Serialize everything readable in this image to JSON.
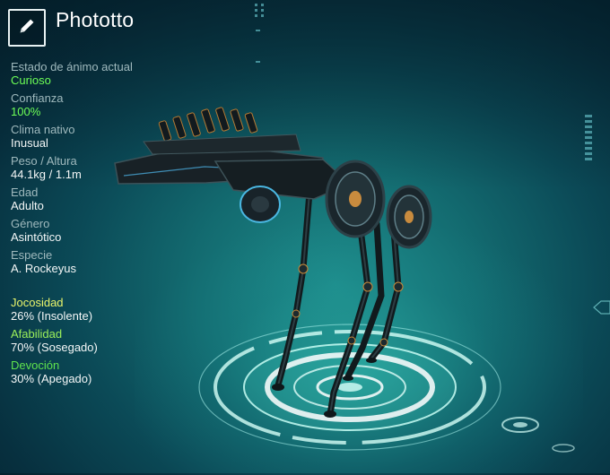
{
  "creature": {
    "name": "Phototto"
  },
  "stats": [
    {
      "label": "Estado de ánimo actual",
      "value": "Curioso",
      "highlight": true
    },
    {
      "label": "Confianza",
      "value": "100%",
      "highlight": true
    },
    {
      "label": "Clima nativo",
      "value": "Inusual",
      "highlight": false
    },
    {
      "label": "Peso / Altura",
      "value": "44.1kg / 1.1m",
      "highlight": false
    },
    {
      "label": "Edad",
      "value": "Adulto",
      "highlight": false
    },
    {
      "label": "Género",
      "value": "Asintótico",
      "highlight": false
    },
    {
      "label": "Especie",
      "value": "A. Rockeyus",
      "highlight": false
    }
  ],
  "traits": [
    {
      "label": "Jocosidad",
      "value": "26% (Insolente)",
      "color": "#e9f46a"
    },
    {
      "label": "Afabilidad",
      "value": "70% (Sosegado)",
      "color": "#9cf05a"
    },
    {
      "label": "Devoción",
      "value": "30% (Apegado)",
      "color": "#5fe34d"
    }
  ],
  "colors": {
    "accent_green": "#6dff56",
    "label_gray": "#9fb9bd",
    "text_white": "#f4f7f7"
  },
  "icons": {
    "edit": "pencil-icon"
  }
}
